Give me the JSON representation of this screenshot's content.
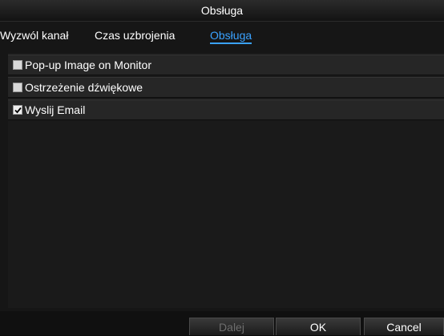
{
  "window": {
    "title": "Obsługa"
  },
  "tabs": [
    {
      "label": "Wyzwól kanał"
    },
    {
      "label": "Czas uzbrojenia"
    },
    {
      "label": "Obsługa",
      "active": true
    }
  ],
  "options": [
    {
      "label": "Pop-up Image on Monitor",
      "checked": false
    },
    {
      "label": "Ostrzeżenie dźwiękowe",
      "checked": false
    },
    {
      "label": "Wyslij Email",
      "checked": true
    }
  ],
  "buttons": {
    "next": {
      "label": "Dalej",
      "enabled": false
    },
    "ok": {
      "label": "OK"
    },
    "cancel": {
      "label": "Cancel"
    }
  },
  "colors": {
    "active_tab": "#3aa2ff",
    "background": "#161616"
  }
}
